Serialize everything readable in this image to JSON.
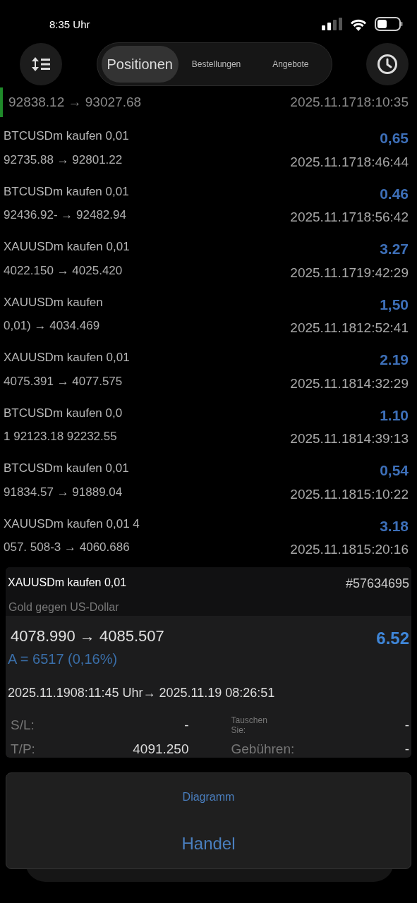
{
  "status_bar": {
    "time": "8:35 Uhr"
  },
  "tabs": [
    {
      "label": "Positionen",
      "selected": true
    },
    {
      "label": "Bestellungen",
      "selected": false
    },
    {
      "label": "Angebote",
      "selected": false
    }
  ],
  "partial_row": {
    "prices": "92838.12 → 93027.68",
    "time": "2025.11.1718:10:35",
    "selected": true
  },
  "positions": [
    {
      "title": "BTCUSDm kaufen 0,01",
      "prices": "92735.88 → 92801.22",
      "profit": "0,65",
      "time": "2025.11.1718:46:44"
    },
    {
      "title": "BTCUSDm kaufen 0,01",
      "prices": "92436.92- → 92482.94",
      "profit": "0.46",
      "time": "2025.11.1718:56:42"
    },
    {
      "title": "XAUUSDm kaufen 0,01",
      "prices": "4022.150 → 4025.420",
      "profit": "3.27",
      "time": "2025.11.1719:42:29"
    },
    {
      "title": "XAUUSDm kaufen",
      "prices": "0,01) → 4034.469",
      "profit": "1,50",
      "time": "2025.11.1812:52:41"
    },
    {
      "title": "XAUUSDm kaufen 0,01",
      "prices": "4075.391 → 4077.575",
      "profit": "2.19",
      "time": "2025.11.1814:32:29"
    },
    {
      "title": "BTCUSDm kaufen 0,0",
      "prices": "1 92123.18 92232.55",
      "profit": "1.10",
      "time": "2025.11.1814:39:13"
    },
    {
      "title": "BTCUSDm kaufen 0,01",
      "prices": "91834.57 → 91889.04",
      "profit": "0,54",
      "time": "2025.11.1815:10:22"
    },
    {
      "title": "XAUUSDm kaufen 0,01 4",
      "prices": "057. 508-3 → 4060.686",
      "profit": "3.18",
      "time": "2025.11.1815:20:16"
    }
  ],
  "detail": {
    "title": "XAUUSDm kaufen 0,01",
    "ticket": "#57634695",
    "description": "Gold gegen US-Dollar",
    "prices": "4078.990 → 4085.507",
    "profit": "6.52",
    "delta": "A = 6517 (0,16%)",
    "times": "2025.11.1908:11:45 Uhr→ 2025.11.19 08:26:51",
    "fields": [
      {
        "label": "S/L:",
        "value": "-"
      },
      {
        "label": "Tauschen Sie:",
        "value": "-"
      },
      {
        "label": "T/P:",
        "value": "4091.250"
      },
      {
        "label": "Gebühren:",
        "value": "-"
      }
    ]
  },
  "actions": [
    "Diagramm",
    "Handel"
  ]
}
